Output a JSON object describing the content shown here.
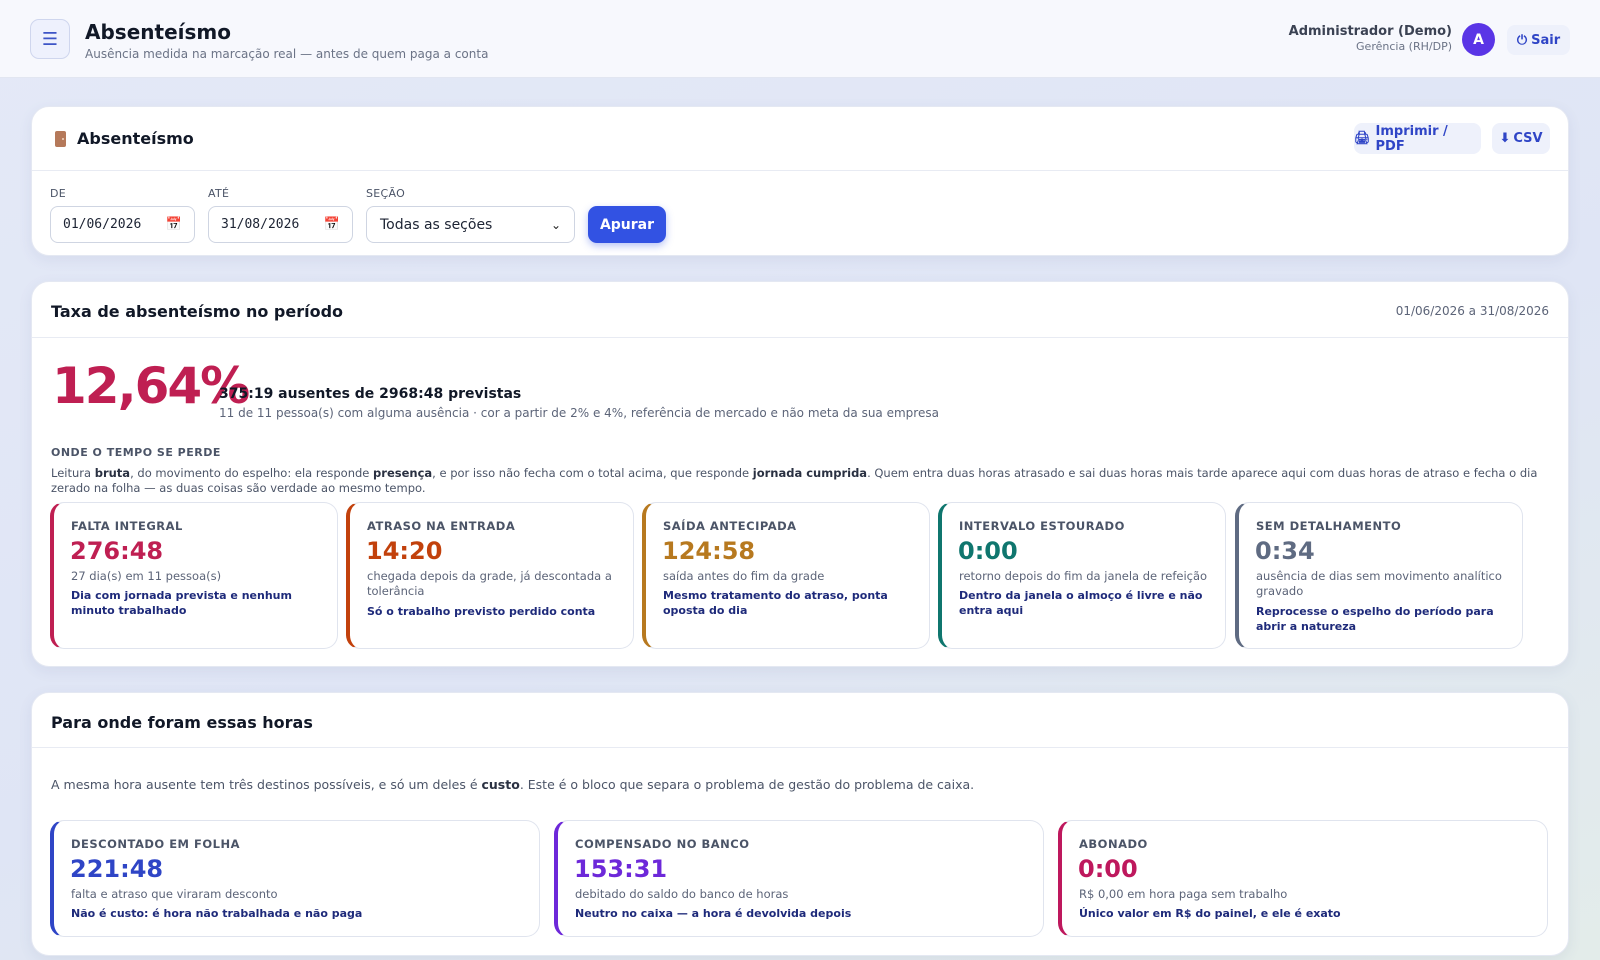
{
  "header": {
    "menu_icon": "hamburger-icon",
    "title": "Absenteísmo",
    "subtitle": "Ausência medida na marcação real — antes de quem paga a conta",
    "user_name": "Administrador (Demo)",
    "user_role": "Gerência (RH/DP)",
    "avatar_letter": "A",
    "logout_label": "Sair",
    "logout_icon": "power-icon"
  },
  "filter": {
    "title": "Absenteísmo",
    "title_icon": "door-icon",
    "print_label": "Imprimir / PDF",
    "print_icon": "printer-icon",
    "csv_label": "CSV",
    "csv_icon": "download-icon",
    "from_label": "DE",
    "from_value": "01/06/2026",
    "to_label": "ATÉ",
    "to_value": "31/08/2026",
    "section_label": "SEÇÃO",
    "section_value": "Todas as seções",
    "apply_label": "Apurar"
  },
  "rate": {
    "title": "Taxa de absenteísmo no período",
    "period": "01/06/2026 a 31/08/2026",
    "rate_value": "12,64%",
    "summary": "375:19 ausentes de 2968:48 previstas",
    "note": "11 de 11 pessoa(s) com alguma ausência · cor a partir de 2% e 4%, referência de mercado e não meta da sua empresa",
    "kicker": "ONDE O TEMPO SE PERDE",
    "desc_parts": [
      "Leitura ",
      "bruta",
      ", do movimento do espelho: ela responde ",
      "presença",
      ", e por isso não fecha com o total acima, que responde ",
      "jornada cumprida",
      ". Quem entra duas horas atrasado e sai duas horas mais tarde aparece aqui com duas horas de atraso e fecha o dia zerado na folha — as duas coisas são verdade ao mesmo tempo."
    ],
    "metrics": [
      {
        "label": "FALTA INTEGRAL",
        "value": "276:48",
        "desc": "27 dia(s) em 11 pessoa(s)",
        "note": "Dia com jornada prevista e nenhum minuto trabalhado",
        "color": "#bf1f52"
      },
      {
        "label": "ATRASO NA ENTRADA",
        "value": "14:20",
        "desc": "chegada depois da grade, já descontada a tolerância",
        "note": "Só o trabalho previsto perdido conta",
        "color": "#c2410c"
      },
      {
        "label": "SAÍDA ANTECIPADA",
        "value": "124:58",
        "desc": "saída antes do fim da grade",
        "note": "Mesmo tratamento do atraso, ponta oposta do dia",
        "color": "#b7791f"
      },
      {
        "label": "INTERVALO ESTOURADO",
        "value": "0:00",
        "desc": "retorno depois do fim da janela de refeição",
        "note": "Dentro da janela o almoço é livre e não entra aqui",
        "color": "#0f766e"
      },
      {
        "label": "SEM DETALHAMENTO",
        "value": "0:34",
        "desc": "ausência de dias sem movimento analítico gravado",
        "note": "Reprocesse o espelho do período para abrir a natureza",
        "color": "#5f6b82"
      }
    ]
  },
  "destinations": {
    "title": "Para onde foram essas horas",
    "desc_parts": [
      "A mesma hora ausente tem três destinos possíveis, e só um deles é ",
      "custo",
      ". Este é o bloco que separa o problema de gestão do problema de caixa."
    ],
    "metrics": [
      {
        "label": "DESCONTADO EM FOLHA",
        "value": "221:48",
        "desc": "falta e atraso que viraram desconto",
        "note": "Não é custo: é hora não trabalhada e não paga",
        "color": "#2f45c6"
      },
      {
        "label": "COMPENSADO NO BANCO",
        "value": "153:31",
        "desc": "debitado do saldo do banco de horas",
        "note": "Neutro no caixa — a hora é devolvida depois",
        "color": "#6d28d9"
      },
      {
        "label": "ABONADO",
        "value": "0:00",
        "desc": "R$ 0,00 em hora paga sem trabalho",
        "note": "Único valor em R$ do painel, e ele é exato",
        "color": "#be185d"
      }
    ]
  }
}
